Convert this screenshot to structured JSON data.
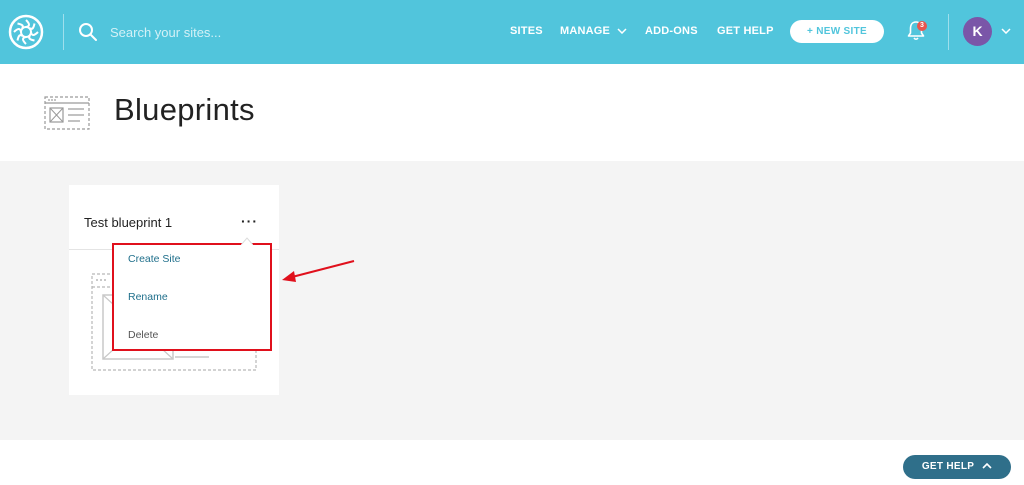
{
  "nav": {
    "search_placeholder": "Search your sites...",
    "items": [
      {
        "label": "SITES"
      },
      {
        "label": "MANAGE"
      },
      {
        "label": "ADD-ONS"
      },
      {
        "label": "GET HELP"
      }
    ],
    "new_site_label": "+ NEW SITE",
    "notification_count": "3",
    "avatar_initial": "K"
  },
  "page": {
    "title": "Blueprints"
  },
  "card": {
    "title": "Test blueprint 1",
    "more_label": "···"
  },
  "menu": {
    "items": [
      {
        "label": "Create Site"
      },
      {
        "label": "Rename"
      },
      {
        "label": "Delete"
      }
    ]
  },
  "footer": {
    "get_help_label": "GET HELP"
  },
  "colors": {
    "topbar": "#51c5dc",
    "highlight": "#e0101c",
    "avatar": "#7a56a8",
    "get_help_pill": "#2f6f8a"
  }
}
